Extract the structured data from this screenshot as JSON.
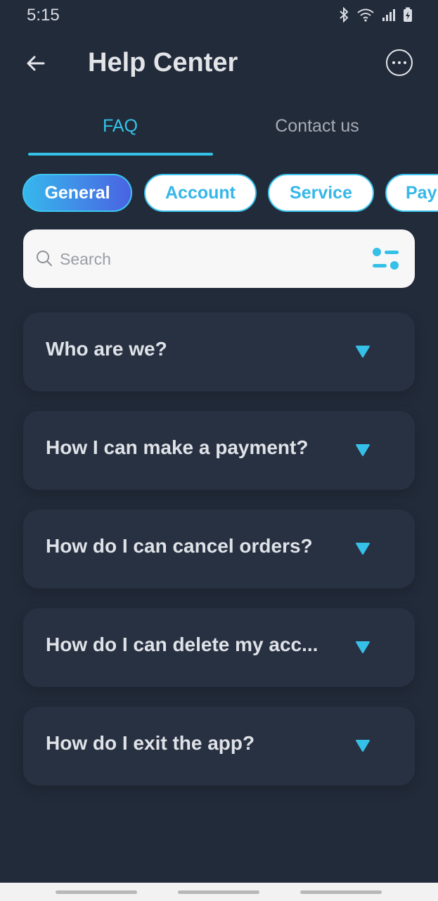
{
  "status_bar": {
    "time": "5:15",
    "icons": [
      "bluetooth-icon",
      "wifi-icon",
      "signal-icon",
      "battery-charging-icon"
    ]
  },
  "header": {
    "title": "Help Center",
    "back_icon": "arrow-left-icon",
    "more_icon": "more-horizontal-icon"
  },
  "tabs": [
    {
      "label": "FAQ",
      "active": true
    },
    {
      "label": "Contact us",
      "active": false
    }
  ],
  "chips": [
    {
      "label": "General",
      "selected": true
    },
    {
      "label": "Account",
      "selected": false
    },
    {
      "label": "Service",
      "selected": false
    },
    {
      "label": "Pay",
      "selected": false
    }
  ],
  "search": {
    "placeholder": "Search",
    "value": ""
  },
  "faq": [
    {
      "question": "Who are we?"
    },
    {
      "question": "How I can make a payment?"
    },
    {
      "question": "How do I can cancel orders?"
    },
    {
      "question": "How do I can delete my acc..."
    },
    {
      "question": "How do I exit the app?"
    }
  ],
  "colors": {
    "background": "#222b3a",
    "accent": "#33c3e8",
    "card": "#283142",
    "chip_gradient_start": "#36b7ec",
    "chip_gradient_end": "#4a63e2"
  }
}
